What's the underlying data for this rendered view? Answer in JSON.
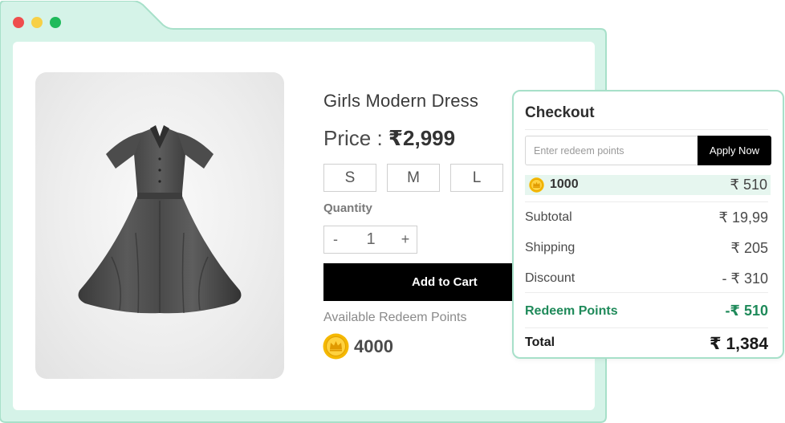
{
  "colors": {
    "frame": "#d5f3e8",
    "frame_border": "#a7e0c9",
    "accent_green": "#1f8a5a",
    "button_black": "#000000",
    "coin_gold": "#f5b800"
  },
  "window": {
    "buttons": [
      "close-dot",
      "minimize-dot",
      "maximize-dot"
    ]
  },
  "product": {
    "title": "Girls Modern Dress",
    "price_label": "Price :",
    "price_value": "₹2,999",
    "sizes": [
      "S",
      "M",
      "L"
    ],
    "quantity_label": "Quantity",
    "quantity_minus": "-",
    "quantity_value": "1",
    "quantity_plus": "+",
    "add_to_cart": "Add to Cart",
    "redeem_label": "Available Redeem Points",
    "redeem_points": "4000",
    "image_icon": "dress-image"
  },
  "checkout": {
    "title": "Checkout",
    "input_placeholder": "Enter redeem points",
    "apply_label": "Apply Now",
    "points_entered": "1000",
    "points_value": "₹ 510",
    "rows": [
      {
        "label": "Subtotal",
        "value": "₹ 19,99"
      },
      {
        "label": "Shipping",
        "value": "₹ 205"
      },
      {
        "label": "Discount",
        "value": "- ₹ 310"
      }
    ],
    "redeem_row": {
      "label": "Redeem Points",
      "value": "-₹ 510"
    },
    "total_row": {
      "label": "Total",
      "value": "₹ 1,384"
    }
  }
}
